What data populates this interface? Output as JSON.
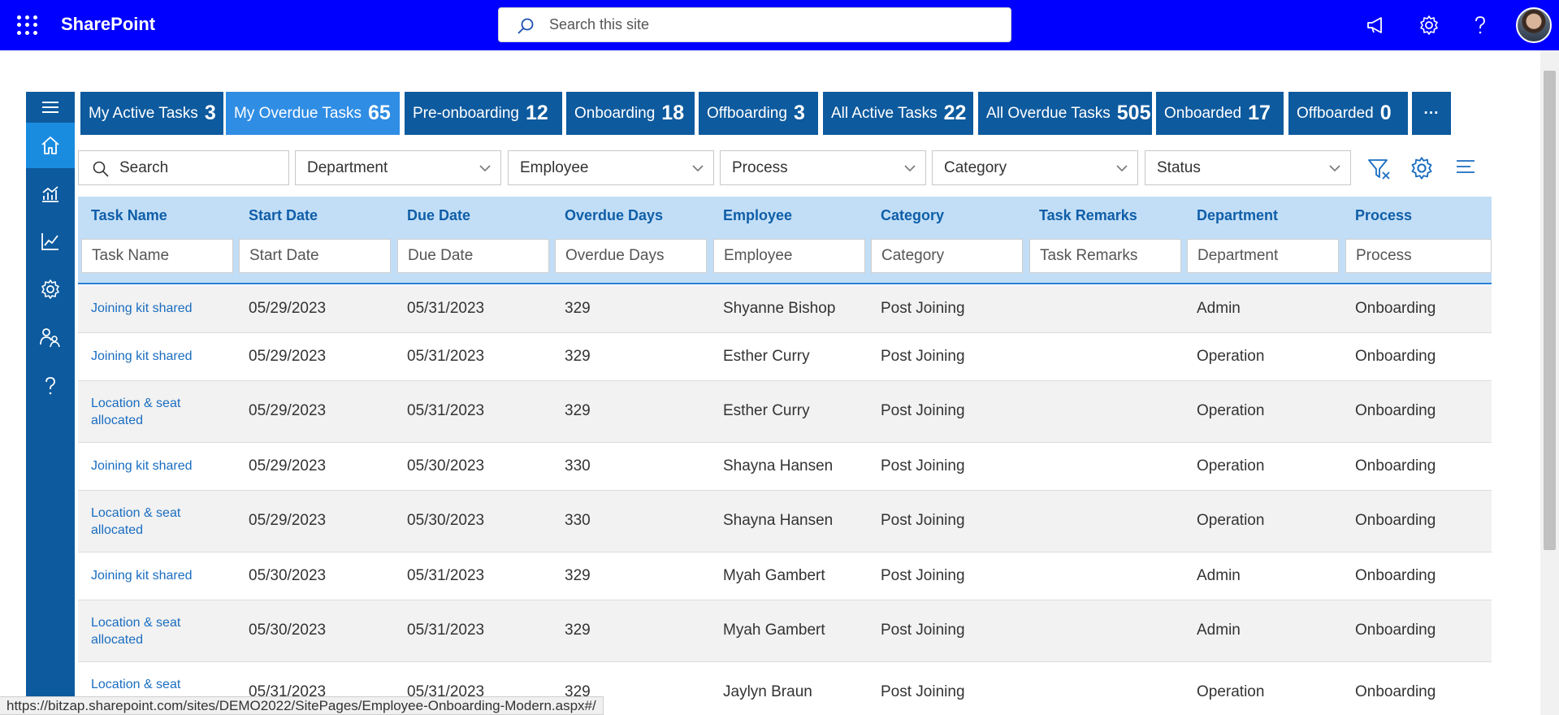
{
  "header": {
    "brand": "SharePoint",
    "search_placeholder": "Search this site"
  },
  "tabs": [
    {
      "label": "My Active Tasks",
      "count": "3"
    },
    {
      "label": "My Overdue Tasks",
      "count": "65"
    },
    {
      "label": "Pre-onboarding",
      "count": "12"
    },
    {
      "label": "Onboarding",
      "count": "18"
    },
    {
      "label": "Offboarding",
      "count": "3"
    },
    {
      "label": "All Active Tasks",
      "count": "22"
    },
    {
      "label": "All Overdue Tasks",
      "count": "505"
    },
    {
      "label": "Onboarded",
      "count": "17"
    },
    {
      "label": "Offboarded",
      "count": "0"
    },
    {
      "label": "···",
      "count": ""
    }
  ],
  "filters": {
    "search_placeholder": "Search",
    "department": "Department",
    "employee": "Employee",
    "process": "Process",
    "category": "Category",
    "status": "Status"
  },
  "columns": [
    "Task Name",
    "Start Date",
    "Due Date",
    "Overdue Days",
    "Employee",
    "Category",
    "Task Remarks",
    "Department",
    "Process"
  ],
  "rows": [
    {
      "task": "Joining kit shared",
      "start": "05/29/2023",
      "due": "05/31/2023",
      "overdue": "329",
      "employee": "Shyanne Bishop",
      "category": "Post Joining",
      "remarks": "",
      "department": "Admin",
      "process": "Onboarding"
    },
    {
      "task": "Joining kit shared",
      "start": "05/29/2023",
      "due": "05/31/2023",
      "overdue": "329",
      "employee": "Esther Curry",
      "category": "Post Joining",
      "remarks": "",
      "department": "Operation",
      "process": "Onboarding"
    },
    {
      "task": "Location & seat allocated",
      "start": "05/29/2023",
      "due": "05/31/2023",
      "overdue": "329",
      "employee": "Esther Curry",
      "category": "Post Joining",
      "remarks": "",
      "department": "Operation",
      "process": "Onboarding"
    },
    {
      "task": "Joining kit shared",
      "start": "05/29/2023",
      "due": "05/30/2023",
      "overdue": "330",
      "employee": "Shayna Hansen",
      "category": "Post Joining",
      "remarks": "",
      "department": "Operation",
      "process": "Onboarding"
    },
    {
      "task": "Location & seat allocated",
      "start": "05/29/2023",
      "due": "05/30/2023",
      "overdue": "330",
      "employee": "Shayna Hansen",
      "category": "Post Joining",
      "remarks": "",
      "department": "Operation",
      "process": "Onboarding"
    },
    {
      "task": "Joining kit shared",
      "start": "05/30/2023",
      "due": "05/31/2023",
      "overdue": "329",
      "employee": "Myah Gambert",
      "category": "Post Joining",
      "remarks": "",
      "department": "Admin",
      "process": "Onboarding"
    },
    {
      "task": "Location & seat allocated",
      "start": "05/30/2023",
      "due": "05/31/2023",
      "overdue": "329",
      "employee": "Myah Gambert",
      "category": "Post Joining",
      "remarks": "",
      "department": "Admin",
      "process": "Onboarding"
    },
    {
      "task": "Location & seat",
      "start": "05/31/2023",
      "due": "05/31/2023",
      "overdue": "329",
      "employee": "Jaylyn Braun",
      "category": "Post Joining",
      "remarks": "",
      "department": "Operation",
      "process": "Onboarding"
    }
  ],
  "status_url": "https://bitzap.sharepoint.com/sites/DEMO2022/SitePages/Employee-Onboarding-Modern.aspx#/",
  "colors": {
    "topbar": "#0000ff",
    "rail": "#0d5a9e",
    "tab_active": "#2f8de4",
    "header_bg": "#c2def6",
    "link": "#1a6dc0"
  }
}
